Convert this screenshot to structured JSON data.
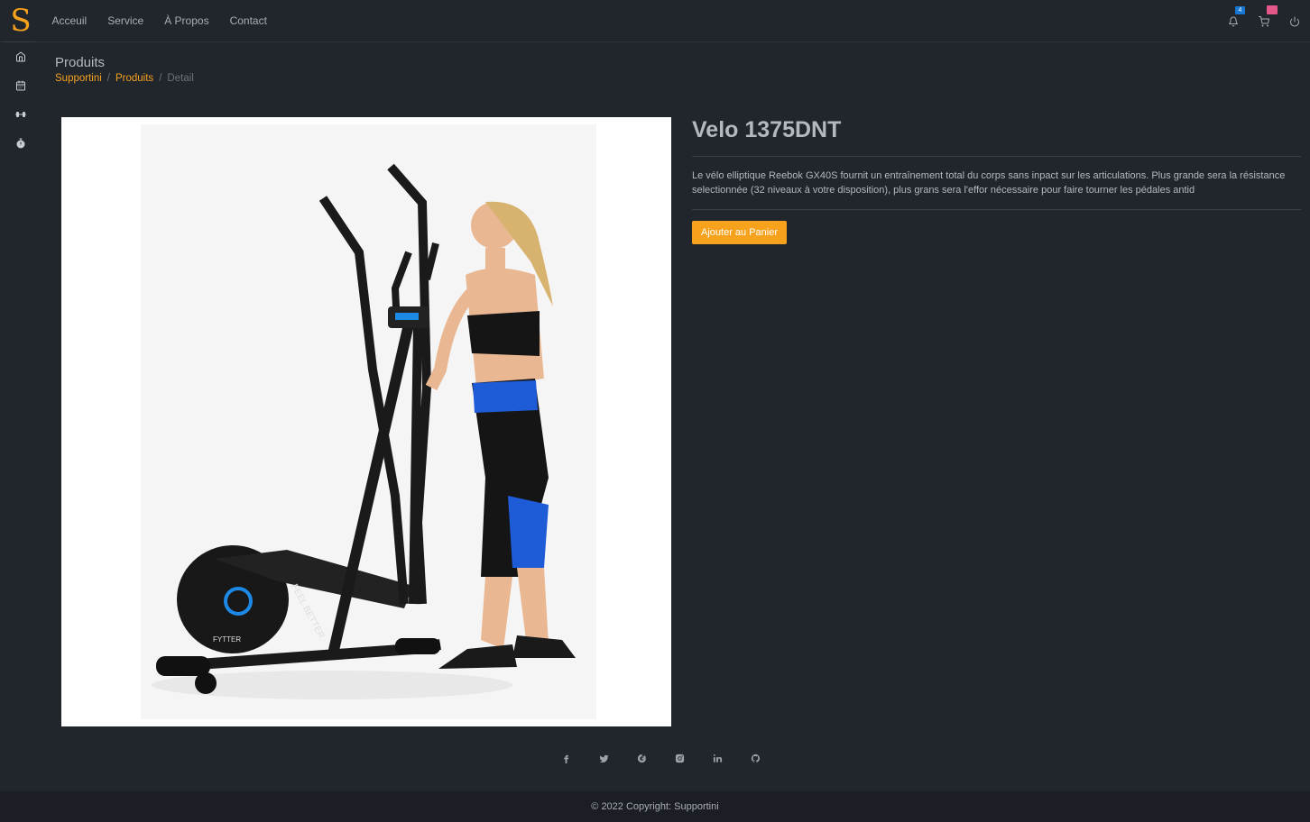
{
  "brand": {
    "logo_letter": "S",
    "color": "#f6a21c"
  },
  "nav": {
    "items": [
      {
        "label": "Acceuil"
      },
      {
        "label": "Service"
      },
      {
        "label": "À Propos"
      },
      {
        "label": "Contact"
      }
    ]
  },
  "top_right": {
    "notifications_count": "4",
    "icons": [
      "bell-icon",
      "cart-icon",
      "power-icon"
    ]
  },
  "sidebar": {
    "icons": [
      "home-icon",
      "calendar-icon",
      "dumbbell-icon",
      "stopwatch-icon"
    ]
  },
  "header": {
    "title": "Produits",
    "breadcrumb": [
      "Supportini",
      "Produits",
      "Detail"
    ]
  },
  "product": {
    "name": "Velo 1375DNT",
    "description": "Le vélo elliptique Reebok GX40S fournit un entraînement total du corps sans inpact sur les articulations. Plus grande sera la résistance selectionnée (32 niveaux à votre disposition), plus grans sera l'effor nécessaire pour faire tourner les pédales antid",
    "add_button": "Ajouter au Panier",
    "image_brand_text": "FEEL BETTER",
    "image_model_text": "FYTTER"
  },
  "social": [
    "facebook-icon",
    "twitter-icon",
    "google-icon",
    "instagram-icon",
    "linkedin-icon",
    "github-icon"
  ],
  "footer": {
    "text": "© 2022 Copyright: Supportini"
  },
  "colors": {
    "accent": "#f6a21c",
    "background": "#21252c",
    "badge_blue": "#1976d2",
    "badge_pink": "#e4578a"
  }
}
